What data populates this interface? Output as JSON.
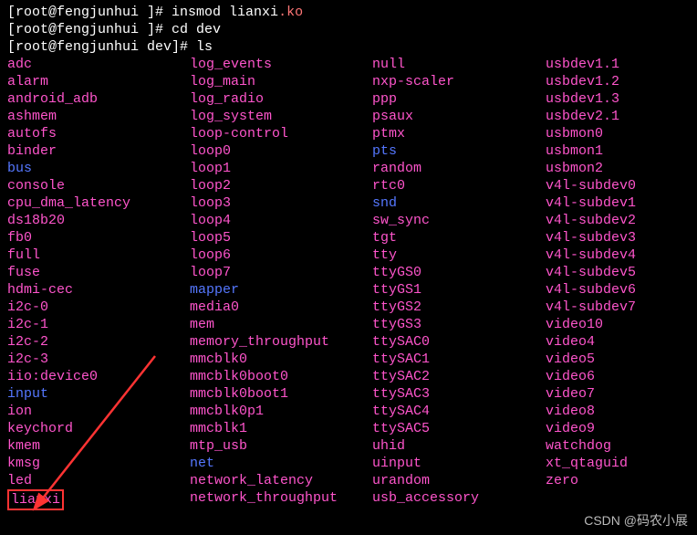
{
  "prompts": [
    {
      "prefix": "[root@fengjunhui ]# ",
      "cmd": "insmod lianxi",
      "ext": ".ko"
    },
    {
      "prefix": "[root@fengjunhui ]# ",
      "cmd": "cd dev",
      "ext": ""
    },
    {
      "prefix": "[root@fengjunhui dev]# ",
      "cmd": "ls",
      "ext": ""
    }
  ],
  "rows": [
    [
      {
        "t": "adc",
        "c": "pink"
      },
      {
        "t": "log_events",
        "c": "pink"
      },
      {
        "t": "null",
        "c": "pink"
      },
      {
        "t": "usbdev1.1",
        "c": "pink"
      }
    ],
    [
      {
        "t": "alarm",
        "c": "pink"
      },
      {
        "t": "log_main",
        "c": "pink"
      },
      {
        "t": "nxp-scaler",
        "c": "pink"
      },
      {
        "t": "usbdev1.2",
        "c": "pink"
      }
    ],
    [
      {
        "t": "android_adb",
        "c": "pink"
      },
      {
        "t": "log_radio",
        "c": "pink"
      },
      {
        "t": "ppp",
        "c": "pink"
      },
      {
        "t": "usbdev1.3",
        "c": "pink"
      }
    ],
    [
      {
        "t": "ashmem",
        "c": "pink"
      },
      {
        "t": "log_system",
        "c": "pink"
      },
      {
        "t": "psaux",
        "c": "pink"
      },
      {
        "t": "usbdev2.1",
        "c": "pink"
      }
    ],
    [
      {
        "t": "autofs",
        "c": "pink"
      },
      {
        "t": "loop-control",
        "c": "pink"
      },
      {
        "t": "ptmx",
        "c": "pink"
      },
      {
        "t": "usbmon0",
        "c": "pink"
      }
    ],
    [
      {
        "t": "binder",
        "c": "pink"
      },
      {
        "t": "loop0",
        "c": "pink"
      },
      {
        "t": "pts",
        "c": "blue"
      },
      {
        "t": "usbmon1",
        "c": "pink"
      }
    ],
    [
      {
        "t": "bus",
        "c": "blue"
      },
      {
        "t": "loop1",
        "c": "pink"
      },
      {
        "t": "random",
        "c": "pink"
      },
      {
        "t": "usbmon2",
        "c": "pink"
      }
    ],
    [
      {
        "t": "console",
        "c": "pink"
      },
      {
        "t": "loop2",
        "c": "pink"
      },
      {
        "t": "rtc0",
        "c": "pink"
      },
      {
        "t": "v4l-subdev0",
        "c": "pink"
      }
    ],
    [
      {
        "t": "cpu_dma_latency",
        "c": "pink"
      },
      {
        "t": "loop3",
        "c": "pink"
      },
      {
        "t": "snd",
        "c": "blue"
      },
      {
        "t": "v4l-subdev1",
        "c": "pink"
      }
    ],
    [
      {
        "t": "ds18b20",
        "c": "pink"
      },
      {
        "t": "loop4",
        "c": "pink"
      },
      {
        "t": "sw_sync",
        "c": "pink"
      },
      {
        "t": "v4l-subdev2",
        "c": "pink"
      }
    ],
    [
      {
        "t": "fb0",
        "c": "pink"
      },
      {
        "t": "loop5",
        "c": "pink"
      },
      {
        "t": "tgt",
        "c": "pink"
      },
      {
        "t": "v4l-subdev3",
        "c": "pink"
      }
    ],
    [
      {
        "t": "full",
        "c": "pink"
      },
      {
        "t": "loop6",
        "c": "pink"
      },
      {
        "t": "tty",
        "c": "pink"
      },
      {
        "t": "v4l-subdev4",
        "c": "pink"
      }
    ],
    [
      {
        "t": "fuse",
        "c": "pink"
      },
      {
        "t": "loop7",
        "c": "pink"
      },
      {
        "t": "ttyGS0",
        "c": "pink"
      },
      {
        "t": "v4l-subdev5",
        "c": "pink"
      }
    ],
    [
      {
        "t": "hdmi-cec",
        "c": "pink"
      },
      {
        "t": "mapper",
        "c": "blue"
      },
      {
        "t": "ttyGS1",
        "c": "pink"
      },
      {
        "t": "v4l-subdev6",
        "c": "pink"
      }
    ],
    [
      {
        "t": "i2c-0",
        "c": "pink"
      },
      {
        "t": "media0",
        "c": "pink"
      },
      {
        "t": "ttyGS2",
        "c": "pink"
      },
      {
        "t": "v4l-subdev7",
        "c": "pink"
      }
    ],
    [
      {
        "t": "i2c-1",
        "c": "pink"
      },
      {
        "t": "mem",
        "c": "pink"
      },
      {
        "t": "ttyGS3",
        "c": "pink"
      },
      {
        "t": "video10",
        "c": "pink"
      }
    ],
    [
      {
        "t": "i2c-2",
        "c": "pink"
      },
      {
        "t": "memory_throughput",
        "c": "pink"
      },
      {
        "t": "ttySAC0",
        "c": "pink"
      },
      {
        "t": "video4",
        "c": "pink"
      }
    ],
    [
      {
        "t": "i2c-3",
        "c": "pink"
      },
      {
        "t": "mmcblk0",
        "c": "pink"
      },
      {
        "t": "ttySAC1",
        "c": "pink"
      },
      {
        "t": "video5",
        "c": "pink"
      }
    ],
    [
      {
        "t": "iio:device0",
        "c": "pink"
      },
      {
        "t": "mmcblk0boot0",
        "c": "pink"
      },
      {
        "t": "ttySAC2",
        "c": "pink"
      },
      {
        "t": "video6",
        "c": "pink"
      }
    ],
    [
      {
        "t": "input",
        "c": "blue"
      },
      {
        "t": "mmcblk0boot1",
        "c": "pink"
      },
      {
        "t": "ttySAC3",
        "c": "pink"
      },
      {
        "t": "video7",
        "c": "pink"
      }
    ],
    [
      {
        "t": "ion",
        "c": "pink"
      },
      {
        "t": "mmcblk0p1",
        "c": "pink"
      },
      {
        "t": "ttySAC4",
        "c": "pink"
      },
      {
        "t": "video8",
        "c": "pink"
      }
    ],
    [
      {
        "t": "keychord",
        "c": "pink"
      },
      {
        "t": "mmcblk1",
        "c": "pink"
      },
      {
        "t": "ttySAC5",
        "c": "pink"
      },
      {
        "t": "video9",
        "c": "pink"
      }
    ],
    [
      {
        "t": "kmem",
        "c": "pink"
      },
      {
        "t": "mtp_usb",
        "c": "pink"
      },
      {
        "t": "uhid",
        "c": "pink"
      },
      {
        "t": "watchdog",
        "c": "pink"
      }
    ],
    [
      {
        "t": "kmsg",
        "c": "pink"
      },
      {
        "t": "net",
        "c": "blue"
      },
      {
        "t": "uinput",
        "c": "pink"
      },
      {
        "t": "xt_qtaguid",
        "c": "pink"
      }
    ],
    [
      {
        "t": "led",
        "c": "pink"
      },
      {
        "t": "network_latency",
        "c": "pink"
      },
      {
        "t": "urandom",
        "c": "pink"
      },
      {
        "t": "zero",
        "c": "pink"
      }
    ],
    [
      {
        "t": "lianxi",
        "c": "pink",
        "hl": true
      },
      {
        "t": "network_throughput",
        "c": "pink"
      },
      {
        "t": "usb_accessory",
        "c": "pink"
      },
      {
        "t": "",
        "c": "pink"
      }
    ]
  ],
  "watermark": "CSDN @码农小展"
}
